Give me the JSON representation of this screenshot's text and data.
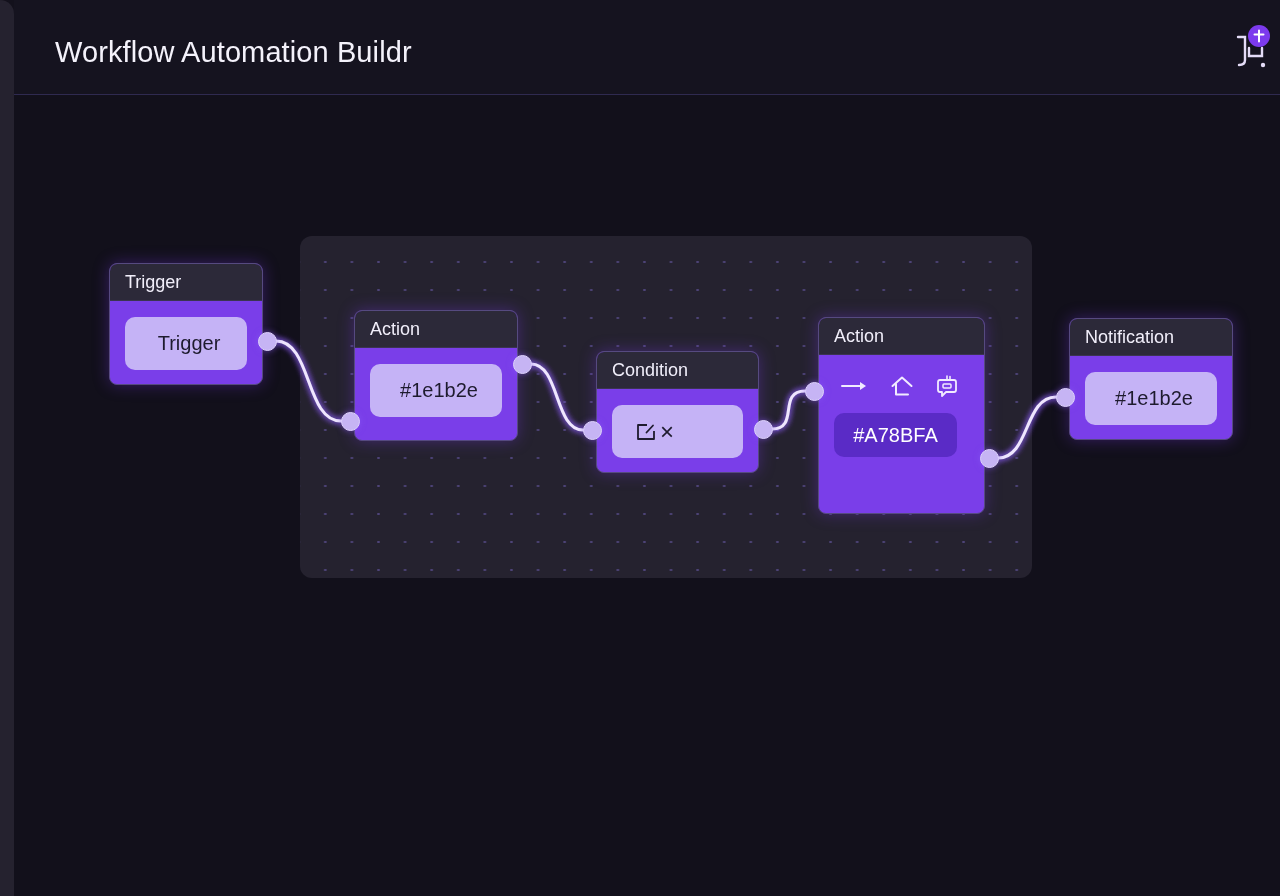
{
  "header": {
    "title": "Workflow Automation Buildr"
  },
  "canvas": {
    "nodes": [
      {
        "title": "Trigger",
        "kind": "text",
        "value": "Trigger",
        "has_input": false,
        "has_output": true
      },
      {
        "title": "Action",
        "kind": "text",
        "value": "#1e1b2e",
        "has_input": true,
        "has_output": true
      },
      {
        "title": "Condition",
        "kind": "icon_text",
        "value": "×",
        "has_input": true,
        "has_output": true
      },
      {
        "title": "Action",
        "kind": "toolbar",
        "value": "#A78BFA",
        "has_input": true,
        "has_output": true
      },
      {
        "title": "Notification",
        "kind": "text",
        "value": "#1e1b2e",
        "has_input": true,
        "has_output": false
      }
    ]
  }
}
